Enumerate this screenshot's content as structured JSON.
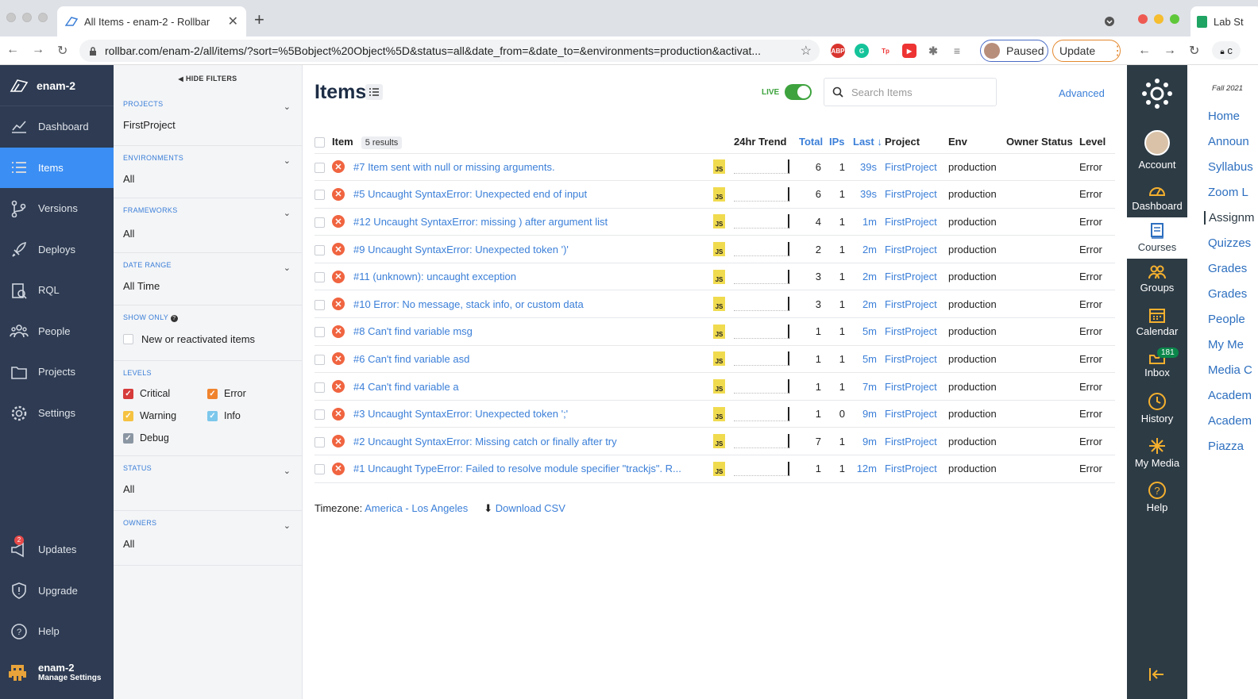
{
  "browser": {
    "tab_title": "All Items - enam-2 - Rollbar",
    "url": "rollbar.com/enam-2/all/items/?sort=%5Bobject%20Object%5D&status=all&date_from=&date_to=&environments=production&activat...",
    "paused_label": "Paused",
    "update_label": "Update"
  },
  "nav": {
    "org": "enam-2",
    "items": [
      {
        "label": "Dashboard",
        "icon": "chart-line-icon"
      },
      {
        "label": "Items",
        "icon": "list-icon"
      },
      {
        "label": "Versions",
        "icon": "branch-icon"
      },
      {
        "label": "Deploys",
        "icon": "rocket-icon"
      },
      {
        "label": "RQL",
        "icon": "query-icon"
      },
      {
        "label": "People",
        "icon": "people-icon"
      },
      {
        "label": "Projects",
        "icon": "folder-icon"
      },
      {
        "label": "Settings",
        "icon": "gear-icon"
      }
    ],
    "bottom": [
      {
        "label": "Updates",
        "badge": "2"
      },
      {
        "label": "Upgrade"
      },
      {
        "label": "Help"
      }
    ],
    "account_name": "enam-2",
    "account_sub": "Manage Settings"
  },
  "filters": {
    "hide_label": "HIDE FILTERS",
    "projects": {
      "label": "PROJECTS",
      "value": "FirstProject"
    },
    "environments": {
      "label": "ENVIRONMENTS",
      "value": "All"
    },
    "frameworks": {
      "label": "FRAMEWORKS",
      "value": "All"
    },
    "date_range": {
      "label": "DATE RANGE",
      "value": "All Time"
    },
    "show_only": {
      "label": "SHOW ONLY",
      "option": "New or reactivated items"
    },
    "levels": {
      "label": "LEVELS",
      "items": [
        {
          "name": "Critical",
          "color": "#d63b3b",
          "checked": true
        },
        {
          "name": "Error",
          "color": "#f0842e",
          "checked": true
        },
        {
          "name": "Warning",
          "color": "#f5c242",
          "checked": true
        },
        {
          "name": "Info",
          "color": "#7cc7ec",
          "checked": true
        },
        {
          "name": "Debug",
          "color": "#8b96a3",
          "checked": true
        }
      ]
    },
    "status": {
      "label": "STATUS",
      "value": "All"
    },
    "owners": {
      "label": "OWNERS",
      "value": "All"
    }
  },
  "main": {
    "title": "Items",
    "live_label": "LIVE",
    "search_placeholder": "Search Items",
    "advanced_label": "Advanced",
    "results_label": "5 results",
    "columns": {
      "item": "Item",
      "trend": "24hr Trend",
      "total": "Total",
      "ips": "IPs",
      "last": "Last ↓",
      "project": "Project",
      "env": "Env",
      "owner": "Owner",
      "status": "Status",
      "level": "Level"
    },
    "rows": [
      {
        "title": "#7 Item sent with null or missing arguments.",
        "total": "6",
        "ips": "1",
        "last": "39s",
        "project": "FirstProject",
        "env": "production",
        "level": "Error"
      },
      {
        "title": "#5 Uncaught SyntaxError: Unexpected end of input",
        "total": "6",
        "ips": "1",
        "last": "39s",
        "project": "FirstProject",
        "env": "production",
        "level": "Error"
      },
      {
        "title": "#12 Uncaught SyntaxError: missing ) after argument list",
        "total": "4",
        "ips": "1",
        "last": "1m",
        "project": "FirstProject",
        "env": "production",
        "level": "Error"
      },
      {
        "title": "#9 Uncaught SyntaxError: Unexpected token ')'",
        "total": "2",
        "ips": "1",
        "last": "2m",
        "project": "FirstProject",
        "env": "production",
        "level": "Error"
      },
      {
        "title": "#11 (unknown): uncaught exception",
        "total": "3",
        "ips": "1",
        "last": "2m",
        "project": "FirstProject",
        "env": "production",
        "level": "Error"
      },
      {
        "title": "#10 Error: No message, stack info, or custom data",
        "total": "3",
        "ips": "1",
        "last": "2m",
        "project": "FirstProject",
        "env": "production",
        "level": "Error"
      },
      {
        "title": "#8 Can't find variable msg",
        "total": "1",
        "ips": "1",
        "last": "5m",
        "project": "FirstProject",
        "env": "production",
        "level": "Error"
      },
      {
        "title": "#6 Can't find variable asd",
        "total": "1",
        "ips": "1",
        "last": "5m",
        "project": "FirstProject",
        "env": "production",
        "level": "Error"
      },
      {
        "title": "#4 Can't find variable a",
        "total": "1",
        "ips": "1",
        "last": "7m",
        "project": "FirstProject",
        "env": "production",
        "level": "Error"
      },
      {
        "title": "#3 Uncaught SyntaxError: Unexpected token ';'",
        "total": "1",
        "ips": "0",
        "last": "9m",
        "project": "FirstProject",
        "env": "production",
        "level": "Error"
      },
      {
        "title": "#2 Uncaught SyntaxError: Missing catch or finally after try",
        "total": "7",
        "ips": "1",
        "last": "9m",
        "project": "FirstProject",
        "env": "production",
        "level": "Error"
      },
      {
        "title": "#1 Uncaught TypeError: Failed to resolve module specifier \"trackjs\". R...",
        "total": "1",
        "ips": "1",
        "last": "12m",
        "project": "FirstProject",
        "env": "production",
        "level": "Error"
      }
    ],
    "timezone_label": "Timezone:",
    "timezone_value": "America - Los Angeles",
    "download_label": "Download CSV"
  },
  "canvas": {
    "tab_title": "Lab St",
    "url_fragment": "c",
    "nav": [
      {
        "label": "Account"
      },
      {
        "label": "Dashboard"
      },
      {
        "label": "Courses"
      },
      {
        "label": "Groups"
      },
      {
        "label": "Calendar"
      },
      {
        "label": "Inbox",
        "badge": "181"
      },
      {
        "label": "History"
      },
      {
        "label": "My Media"
      },
      {
        "label": "Help"
      }
    ],
    "term": "Fall 2021",
    "course_links": [
      "Home",
      "Announ",
      "Syllabus",
      "Zoom L",
      "Assignm",
      "Quizzes",
      "Grades",
      "Grades",
      "People",
      "My Me",
      "Media C",
      "Academ",
      "Academ",
      "Piazza"
    ]
  }
}
